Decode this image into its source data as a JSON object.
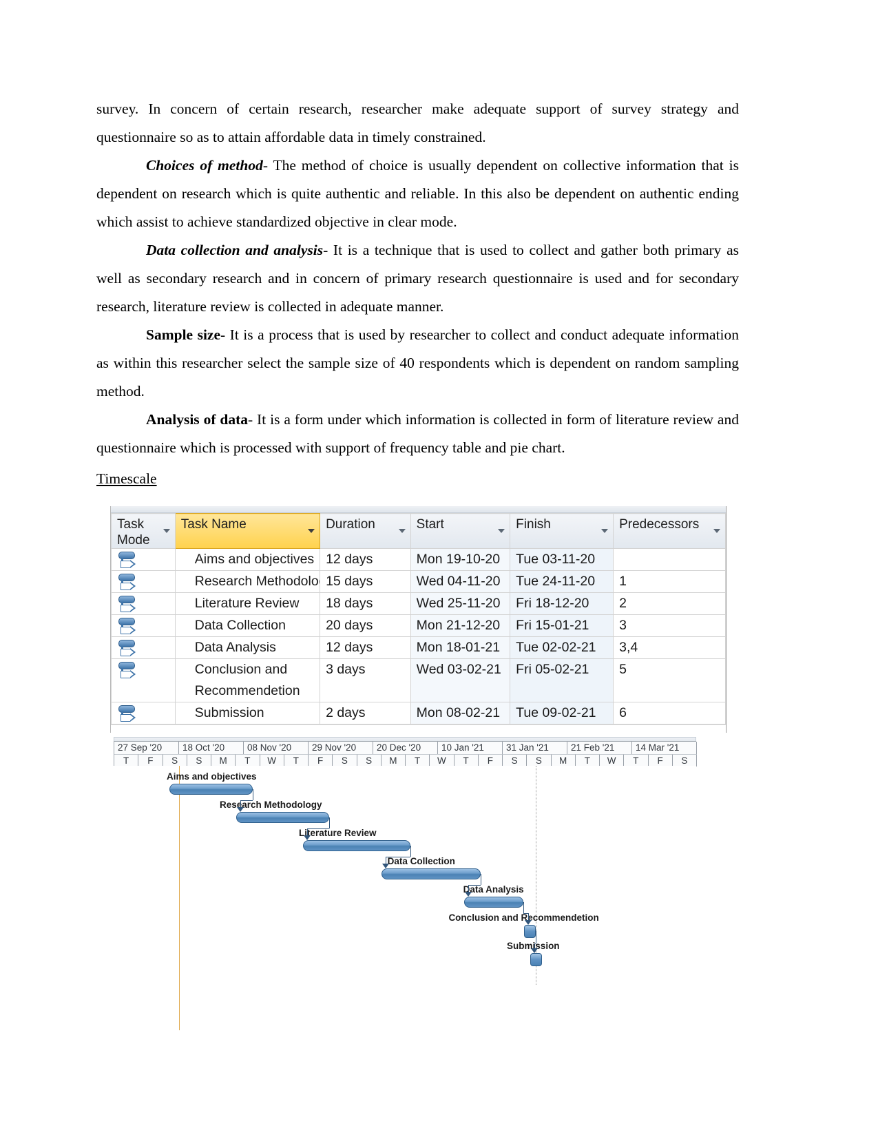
{
  "document": {
    "paragraphs": [
      {
        "id": "p1",
        "indent": false,
        "lead": "",
        "lead_style": "none",
        "text": "survey. In concern of certain research, researcher make adequate support of survey strategy and questionnaire so as to attain affordable data in timely constrained."
      },
      {
        "id": "p2",
        "indent": true,
        "lead": "Choices of method",
        "lead_style": "bold-italic",
        "text": "- The method of choice is usually dependent on collective information that is dependent on research which is quite authentic and reliable. In this also be dependent on authentic ending which assist to achieve standardized objective in clear mode."
      },
      {
        "id": "p3",
        "indent": true,
        "lead": "Data collection and analysis",
        "lead_style": "bold-italic",
        "text": "- It is a technique that is used to collect and gather both primary as well as secondary research and in concern of primary research questionnaire is used and for secondary research, literature review is collected in adequate manner."
      },
      {
        "id": "p4",
        "indent": true,
        "lead": "Sample size",
        "lead_style": "bold",
        "text": "- It is a process that is used by researcher to collect and conduct adequate information as within this researcher select the sample size of 40 respondents which is dependent on random sampling method."
      },
      {
        "id": "p5",
        "indent": true,
        "lead": "Analysis of data",
        "lead_style": "bold",
        "text": "- It is a form under which information is collected in form of literature review and questionnaire which is processed with support of frequency table and pie chart."
      }
    ],
    "section_heading": "Timescale"
  },
  "project_table": {
    "columns": [
      {
        "key": "task_mode",
        "label": "Task Mode",
        "label_line1": "Task",
        "label_line2": "Mode",
        "highlighted": false
      },
      {
        "key": "task_name",
        "label": "Task Name",
        "highlighted": true
      },
      {
        "key": "duration",
        "label": "Duration",
        "highlighted": false
      },
      {
        "key": "start",
        "label": "Start",
        "highlighted": false
      },
      {
        "key": "finish",
        "label": "Finish",
        "highlighted": false
      },
      {
        "key": "predecessors",
        "label": "Predecessors",
        "highlighted": false
      }
    ],
    "rows": [
      {
        "id": 1,
        "mode_icon": "manually-scheduled-icon",
        "task_name": "Aims and objectives",
        "duration": "12 days",
        "start": "Mon 19-10-20",
        "finish": "Tue 03-11-20",
        "predecessors": ""
      },
      {
        "id": 2,
        "mode_icon": "manually-scheduled-icon",
        "task_name": "Research Methodology",
        "duration": "15 days",
        "start": "Wed 04-11-20",
        "finish": "Tue 24-11-20",
        "predecessors": "1"
      },
      {
        "id": 3,
        "mode_icon": "manually-scheduled-icon",
        "task_name": "Literature Review",
        "duration": "18 days",
        "start": "Wed 25-11-20",
        "finish": "Fri 18-12-20",
        "predecessors": "2"
      },
      {
        "id": 4,
        "mode_icon": "manually-scheduled-icon",
        "task_name": "Data Collection",
        "duration": "20 days",
        "start": "Mon 21-12-20",
        "finish": "Fri 15-01-21",
        "predecessors": "3"
      },
      {
        "id": 5,
        "mode_icon": "manually-scheduled-icon",
        "task_name": "Data Analysis",
        "duration": "12 days",
        "start": "Mon 18-01-21",
        "finish": "Tue 02-02-21",
        "predecessors": "3,4"
      },
      {
        "id": 6,
        "mode_icon": "manually-scheduled-icon",
        "task_name": "Conclusion and Recommendetion",
        "duration": "3 days",
        "start": "Wed 03-02-21",
        "finish": "Fri 05-02-21",
        "predecessors": "5",
        "two_line": true
      },
      {
        "id": 7,
        "mode_icon": "manually-scheduled-icon",
        "task_name": "Submission",
        "duration": "2 days",
        "start": "Mon 08-02-21",
        "finish": "Tue 09-02-21",
        "predecessors": "6"
      }
    ]
  },
  "chart_data": {
    "type": "gantt",
    "title": "Timescale",
    "timescale": {
      "major_ticks": [
        "27 Sep '20",
        "18 Oct '20",
        "08 Nov '20",
        "29 Nov '20",
        "20 Dec '20",
        "10 Jan '21",
        "31 Jan '21",
        "21 Feb '21",
        "14 Mar '21"
      ],
      "minor_ticks": [
        "T",
        "F",
        "S",
        "S",
        "M",
        "T",
        "W",
        "T",
        "F",
        "S",
        "S",
        "M",
        "T",
        "W",
        "T",
        "F",
        "S",
        "S",
        "M",
        "T",
        "W",
        "T",
        "F",
        "S"
      ],
      "start": "27 Sep '20",
      "end": "14 Mar '21"
    },
    "tasks": [
      {
        "name": "Aims and objectives",
        "start": "Mon 19-10-20",
        "finish": "Tue 03-11-20",
        "duration_days": 12,
        "type": "task",
        "bar_left_pct": 9.6,
        "bar_width_pct": 14.3,
        "row": 0,
        "label_left_pct": 9.1,
        "predecessors": []
      },
      {
        "name": "Research Methodology",
        "start": "Wed 04-11-20",
        "finish": "Tue 24-11-20",
        "duration_days": 15,
        "type": "task",
        "bar_left_pct": 21.0,
        "bar_width_pct": 16.0,
        "row": 1,
        "label_left_pct": 18.2,
        "predecessors": [
          1
        ]
      },
      {
        "name": "Literature Review",
        "start": "Wed 25-11-20",
        "finish": "Fri 18-12-20",
        "duration_days": 18,
        "type": "task",
        "bar_left_pct": 32.5,
        "bar_width_pct": 18.5,
        "row": 2,
        "label_left_pct": 31.8,
        "predecessors": [
          2
        ]
      },
      {
        "name": "Data Collection",
        "start": "Mon 21-12-20",
        "finish": "Fri 15-01-21",
        "duration_days": 20,
        "type": "task",
        "bar_left_pct": 46.0,
        "bar_width_pct": 17.0,
        "row": 3,
        "label_left_pct": 47.0,
        "predecessors": [
          3
        ]
      },
      {
        "name": "Data Analysis",
        "start": "Mon 18-01-21",
        "finish": "Tue 02-02-21",
        "duration_days": 12,
        "type": "task",
        "bar_left_pct": 60.2,
        "bar_width_pct": 10.1,
        "row": 4,
        "label_left_pct": 60.0,
        "predecessors": [
          3,
          4
        ]
      },
      {
        "name": "Conclusion and Recommendetion",
        "start": "Wed 03-02-21",
        "finish": "Fri 05-02-21",
        "duration_days": 3,
        "type": "milestone",
        "bar_left_pct": 70.5,
        "bar_width_pct": 2.0,
        "row": 5,
        "label_left_pct": 57.5,
        "predecessors": [
          5
        ]
      },
      {
        "name": "Submission",
        "start": "Mon 08-02-21",
        "finish": "Tue 09-02-21",
        "duration_days": 2,
        "type": "milestone",
        "bar_left_pct": 71.5,
        "bar_width_pct": 1.6,
        "row": 6,
        "label_left_pct": 67.5,
        "predecessors": [
          6
        ]
      }
    ],
    "markers": {
      "today_line_pct": 11.2,
      "status_line_pct": 72.5
    },
    "colors": {
      "bar_fill": "#6e9fcd",
      "bar_border": "#2f5f8c",
      "link_line": "#31557a",
      "today_line": "#e0a94c",
      "highlight_header": "#ffd24d"
    }
  }
}
